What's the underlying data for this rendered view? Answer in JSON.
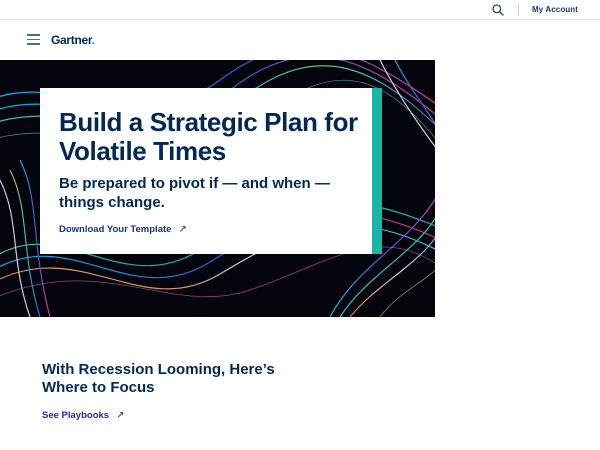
{
  "utility_bar": {
    "search_icon": "search-icon",
    "account_label": "My Account"
  },
  "header": {
    "menu_icon": "hamburger-menu-icon",
    "logo_text": "Gartner",
    "logo_dot": ".",
    "brand_color": "#002856",
    "accent_color": "#17b6a8"
  },
  "hero": {
    "title": "Build a Strategic Plan for Volatile Times",
    "subtitle": "Be prepared to pivot if — and when — things change.",
    "cta_label": "Download Your Template",
    "cta_icon": "arrow-up-right-icon",
    "link_color": "#1b2f9c"
  },
  "section": {
    "title": "With Recession Looming, Here’s Where to Focus",
    "link_label": "See Playbooks",
    "link_icon": "arrow-up-right-icon"
  }
}
